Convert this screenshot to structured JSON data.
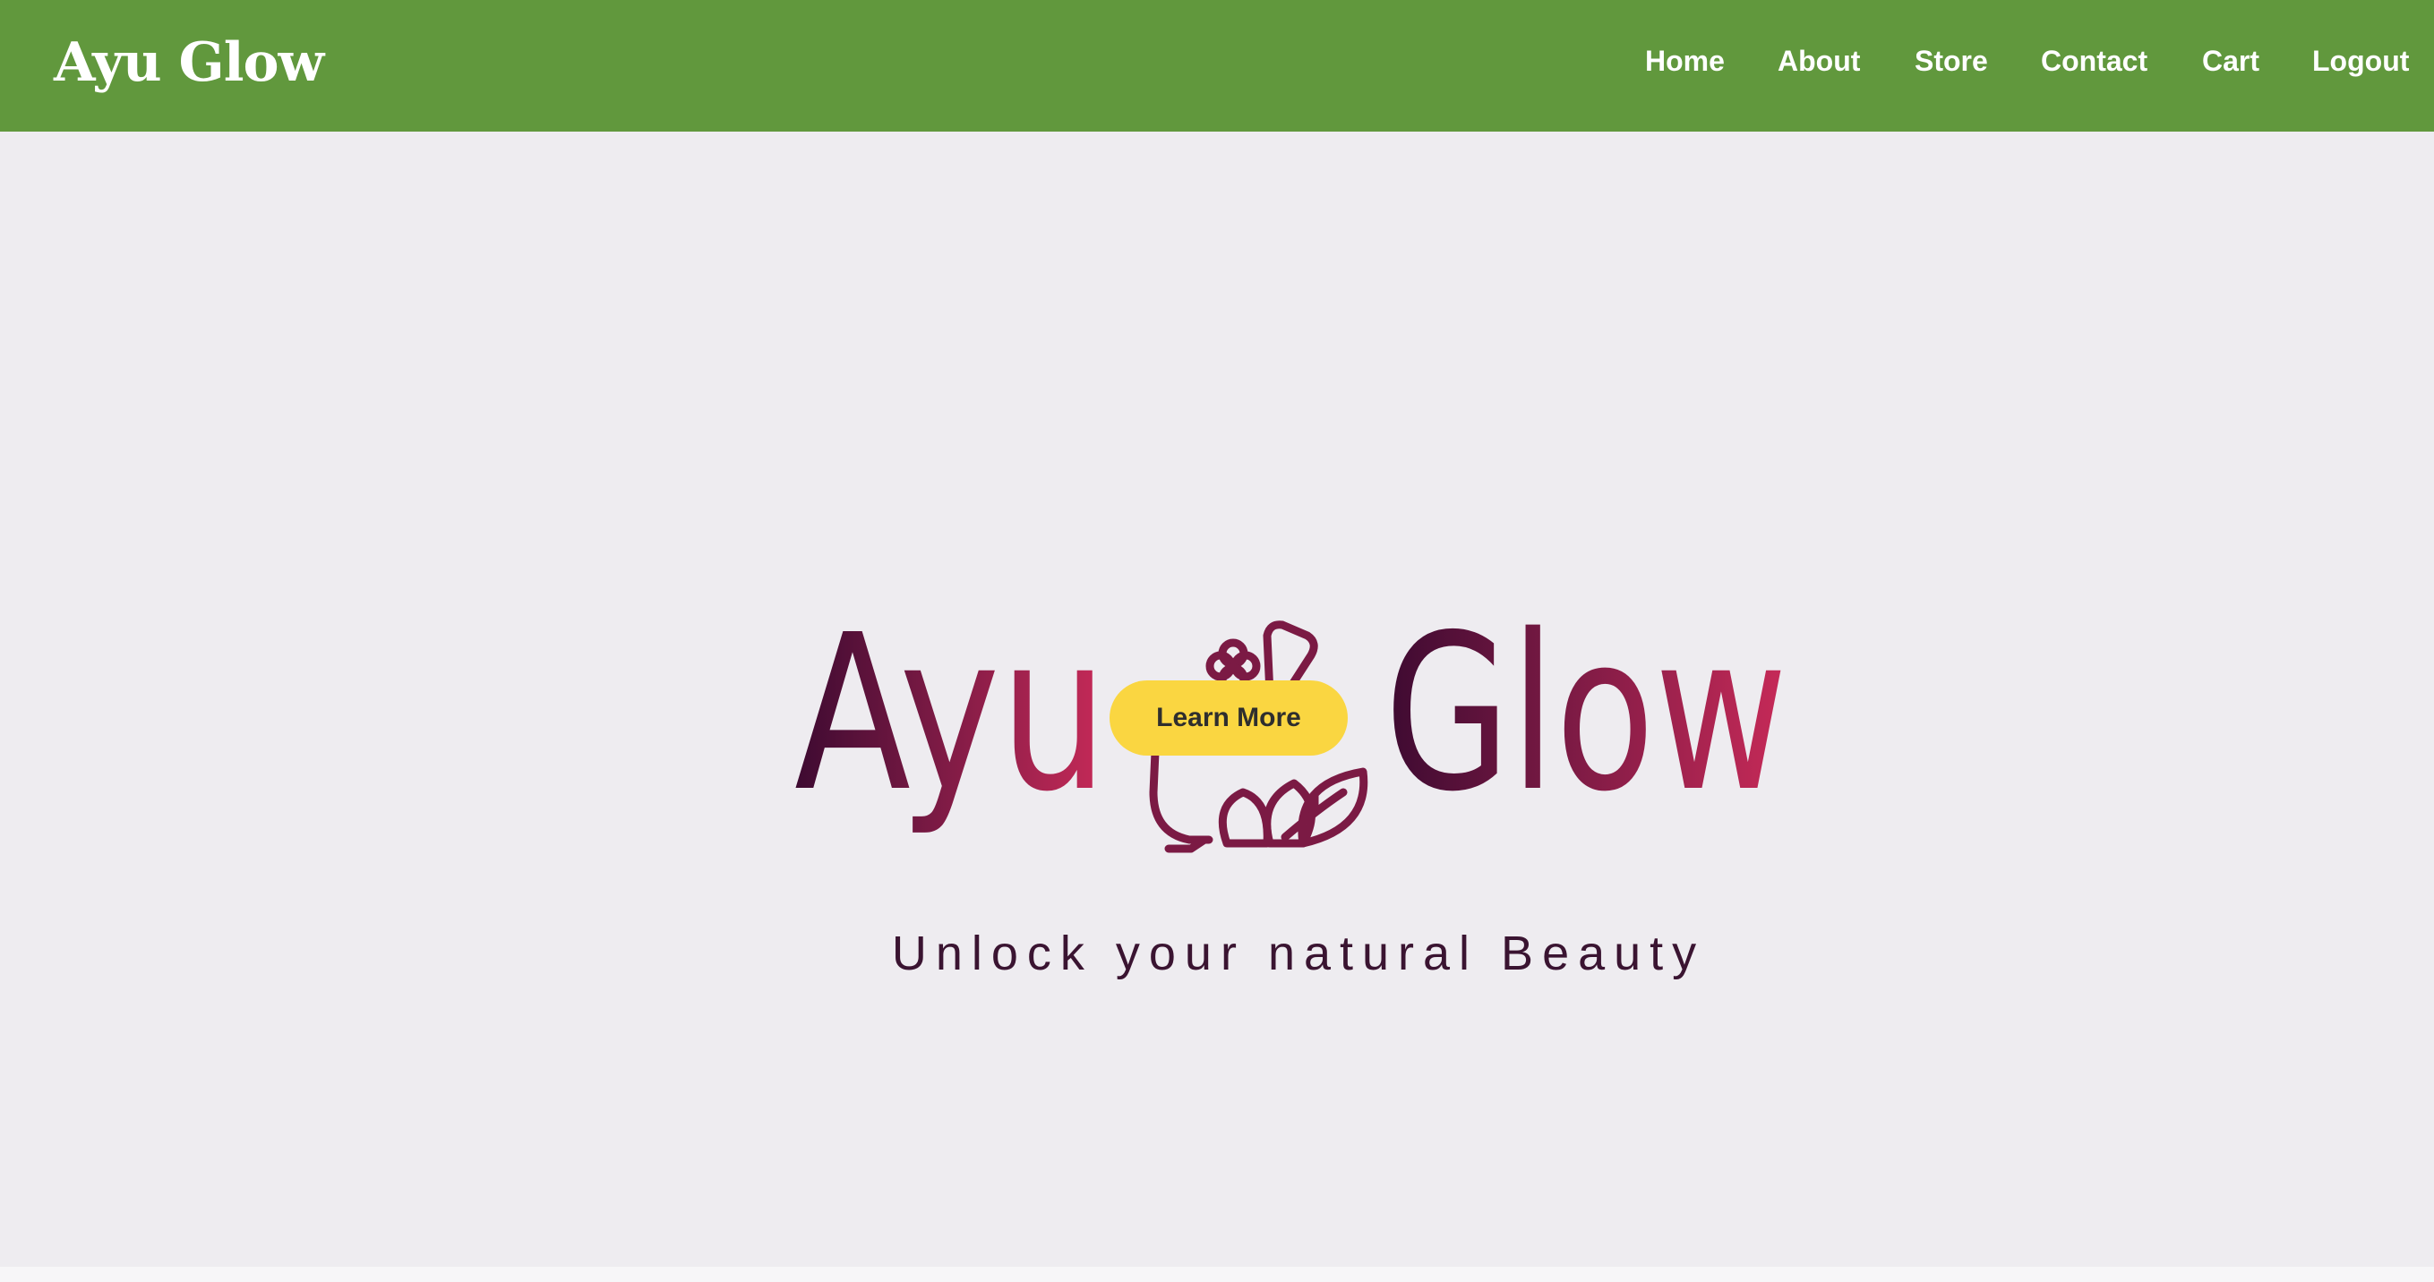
{
  "nav": {
    "brand": "Ayu Glow",
    "links": [
      {
        "label": "Home"
      },
      {
        "label": "About"
      },
      {
        "label": "Store"
      },
      {
        "label": "Contact"
      },
      {
        "label": "Cart"
      },
      {
        "label": "Logout"
      }
    ]
  },
  "hero": {
    "logo": {
      "word_left": "Ayu",
      "word_right": "Glow",
      "colors": {
        "dark": "#3d0a31",
        "mid": "#7b1a44",
        "light": "#c72a58"
      }
    },
    "tagline": "Unlock your natural Beauty",
    "cta_label": "Learn More"
  },
  "colors": {
    "navbar": "#61983d",
    "background": "#eeecf0",
    "button": "#fad641"
  }
}
